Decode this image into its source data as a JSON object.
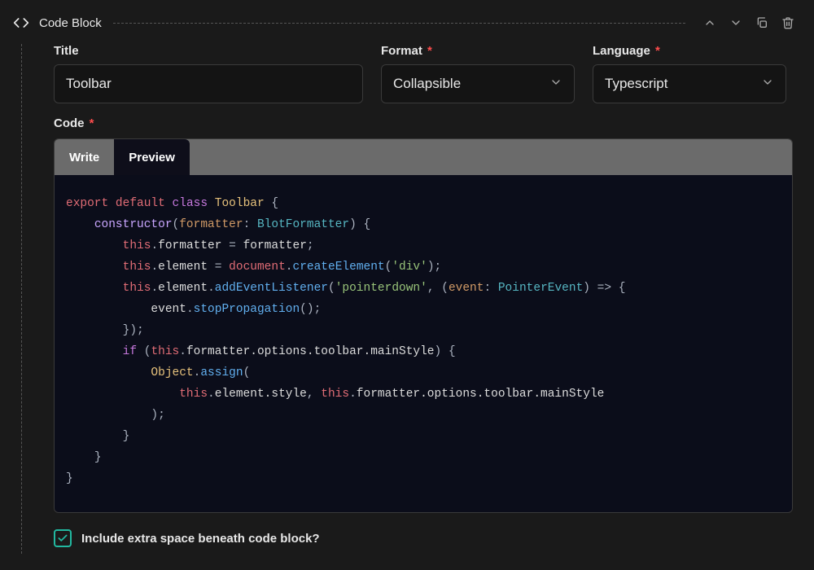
{
  "header": {
    "block_type": "Code Block"
  },
  "fields": {
    "title_label": "Title",
    "title_value": "Toolbar",
    "format_label": "Format",
    "format_value": "Collapsible",
    "language_label": "Language",
    "language_value": "Typescript",
    "code_label": "Code",
    "required_marker": "*"
  },
  "tabs": {
    "write": "Write",
    "preview": "Preview",
    "active": "preview"
  },
  "code": {
    "l1_export": "export",
    "l1_default": "default",
    "l1_class": "class",
    "l1_name": "Toolbar",
    "l2_constructor": "constructor",
    "l2_param": "formatter",
    "l2_type": "BlotFormatter",
    "l3_this": "this",
    "l3_prop": "formatter",
    "l3_rhs": "formatter",
    "l4_this": "this",
    "l4_prop": "element",
    "l4_doc": "document",
    "l4_fn": "createElement",
    "l4_str": "'div'",
    "l5_this": "this",
    "l5_prop": "element",
    "l5_fn": "addEventListener",
    "l5_str": "'pointerdown'",
    "l5_param": "event",
    "l5_type": "PointerEvent",
    "l6_evt": "event",
    "l6_fn": "stopPropagation",
    "l7_if": "if",
    "l7_this": "this",
    "l7_path": "formatter.options.toolbar.mainStyle",
    "l8_obj": "Object",
    "l8_fn": "assign",
    "l9_this1": "this",
    "l9_p1": "element.style",
    "l9_this2": "this",
    "l9_p2": "formatter.options.toolbar.mainStyle"
  },
  "checkbox": {
    "label": "Include extra space beneath code block?",
    "checked": true
  }
}
